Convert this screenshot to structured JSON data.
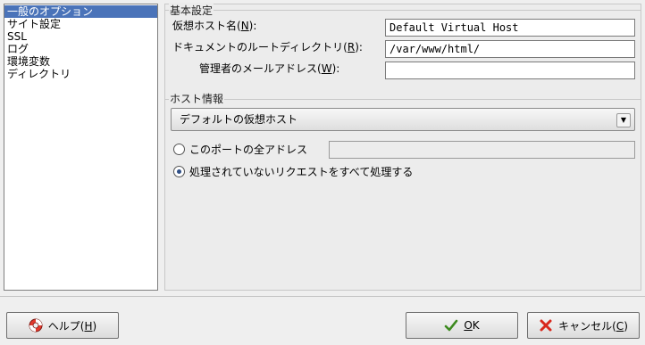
{
  "sidebar": {
    "items": [
      {
        "label": "一般のオプション",
        "selected": true
      },
      {
        "label": "サイト設定",
        "selected": false
      },
      {
        "label": "SSL",
        "selected": false
      },
      {
        "label": "ログ",
        "selected": false
      },
      {
        "label": "環境変数",
        "selected": false
      },
      {
        "label": "ディレクトリ",
        "selected": false
      }
    ]
  },
  "basic": {
    "title": "基本設定",
    "vhost_label_pre": "仮想ホスト名(",
    "vhost_mnemonic": "N",
    "vhost_label_post": "):",
    "vhost_value": "Default Virtual Host",
    "docroot_label_pre": "ドキュメントのルートディレクトリ(",
    "docroot_mnemonic": "R",
    "docroot_label_post": "):",
    "docroot_value": "/var/www/html/",
    "admin_label_pre": "管理者のメールアドレス(",
    "admin_mnemonic": "W",
    "admin_label_post": "):",
    "admin_value": ""
  },
  "host": {
    "title": "ホスト情報",
    "combo_value": "デフォルトの仮想ホスト",
    "radio_all_addresses": "このポートの全アドレス",
    "radio_all_addresses_value": "",
    "radio_unhandled": "処理されていないリクエストをすべて処理する",
    "selected_radio": "unhandled"
  },
  "buttons": {
    "help_pre": "ヘルプ(",
    "help_mnemonic": "H",
    "help_post": ")",
    "ok_mnemonic": "O",
    "ok_post": "K",
    "cancel_pre": "キャンセル(",
    "cancel_mnemonic": "C",
    "cancel_post": ")"
  },
  "colors": {
    "selection": "#4a73b9",
    "window_bg": "#efefef"
  }
}
